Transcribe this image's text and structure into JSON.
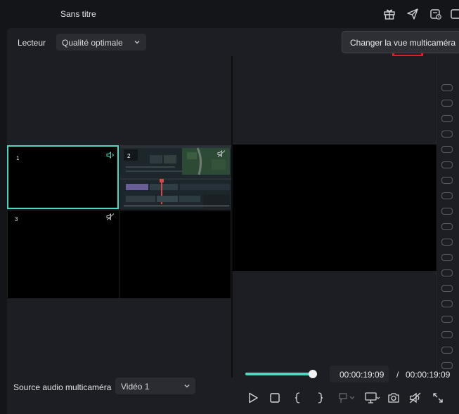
{
  "window": {
    "title": "Sans titre"
  },
  "toolbar": {
    "player_label": "Lecteur",
    "quality": "Qualité optimale"
  },
  "tooltip": {
    "text": "Changer la vue multicaméra"
  },
  "cells": [
    {
      "number": "1",
      "active": true,
      "audio": "on"
    },
    {
      "number": "2",
      "active": false,
      "audio": "muted"
    },
    {
      "number": "3",
      "active": false,
      "audio": "muted"
    },
    {
      "number": "",
      "active": false,
      "audio": "none"
    }
  ],
  "audio_source": {
    "label": "Source audio multicaméra",
    "selected": "Vidéo 1"
  },
  "playback": {
    "progress": 1.0,
    "current_time": "00:00:19:09",
    "separator": "/",
    "total_time": "00:00:19:09"
  },
  "colors": {
    "accent": "#4fd8c0",
    "highlight": "#e02020",
    "panel": "#1c1e23"
  }
}
